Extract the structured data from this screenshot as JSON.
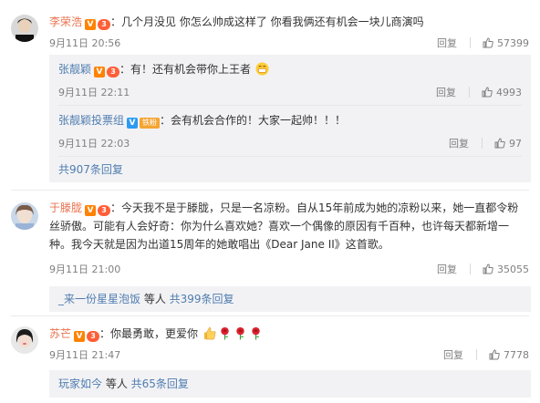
{
  "c1": {
    "name": "李荣浩",
    "level": "3",
    "text": "：几个月没见 你怎么帅成这样了 你看我俩还有机会一块儿商演吗",
    "time": "9月11日 20:56",
    "reply": "回复",
    "likes": "57399",
    "replies": [
      {
        "name": "张靓颖",
        "level": "3",
        "text": "：有！还有机会带你上王者",
        "time": "9月11日 22:11",
        "reply": "回复",
        "likes": "4993"
      },
      {
        "name": "张靓颖投票组",
        "badge": "铁粉",
        "text": "：会有机会合作的！大家一起帅！！！",
        "time": "9月11日 22:03",
        "reply": "回复",
        "likes": "97"
      }
    ],
    "more": "共907条回复"
  },
  "c2": {
    "name": "于滕胧",
    "level": "3",
    "text_lines": [
      "：今天我不是于滕胧，只是一名凉粉。自从15年前成为她的凉粉以来，她一直都令粉",
      "丝骄傲。可能有人会好奇：你为什么喜欢她？喜欢一个偶像的原因有千百种，也许每天都新增一",
      "种。我今天就是因为出道15周年的她敢唱出《Dear Jane II》这首歌。"
    ],
    "time": "9月11日 21:00",
    "reply": "回复",
    "likes": "35055",
    "more_user": "_来一份星星泡饭",
    "more_mid": " 等人 ",
    "more": "共399条回复"
  },
  "c3": {
    "name": "苏芒",
    "level": "3",
    "text": "：你最勇敢，更爱你",
    "time": "9月11日 21:47",
    "reply": "回复",
    "likes": "7778",
    "more_user": "玩家如今",
    "more_mid": " 等人 ",
    "more": "共65条回复"
  },
  "icons": {
    "verified": "V",
    "thumb": "thumb-up-icon",
    "emoji_grin": "grin-emoji",
    "emoji_thumb": "thumbs-up-emoji",
    "emoji_rose": "rose-emoji"
  },
  "colors": {
    "name_orange": "#eb7350",
    "name_blue": "#507daf",
    "meta_gray": "#808080",
    "reply_bg": "#f2f2f5"
  }
}
